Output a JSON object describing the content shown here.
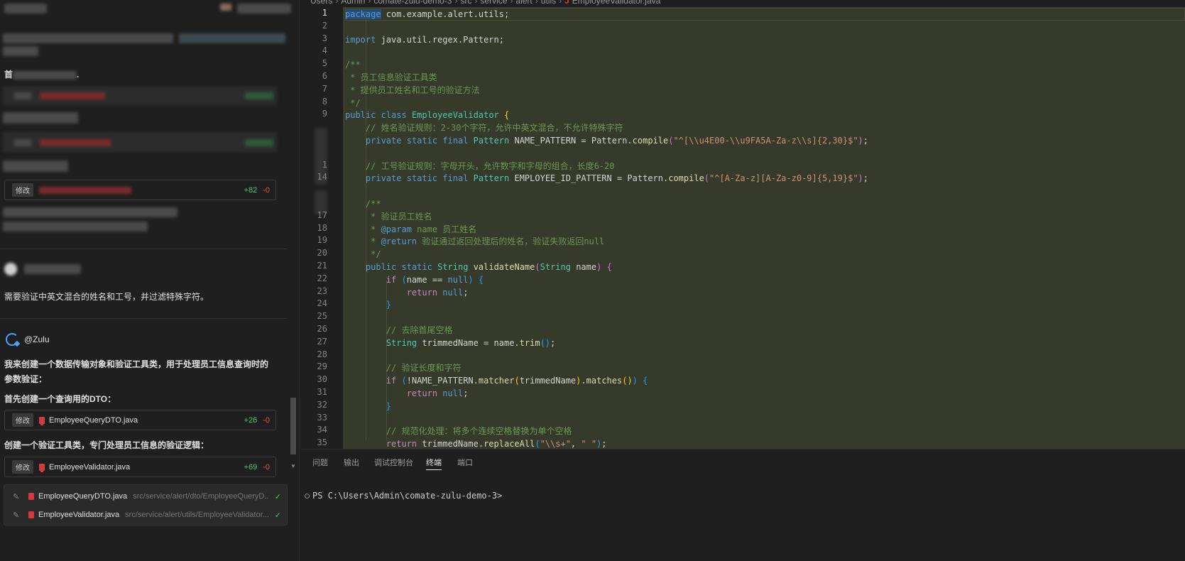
{
  "breadcrumb": [
    "Users",
    "Admin",
    "comate-zulu-demo-3",
    "src",
    "service",
    "alert",
    "utils"
  ],
  "breadcrumb_file": "EmployeeValidator.java",
  "breadcrumb_file_icon": "J",
  "chat": {
    "fragment_shou": "首",
    "fragment_dot": ".",
    "badge_partial": "修改",
    "add_partial": "+82",
    "del_partial": "-0",
    "user_message": "需要验证中英文混合的姓名和工号，并过滤特殊字符。",
    "agent_name": "@Zulu",
    "agent_intro_line1": "我来创建一个数据传输对象和验证工具类，用于处理员工信息查询时的",
    "agent_intro_line2": "参数验证：",
    "step1": "首先创建一个查询用的DTO：",
    "card1": {
      "badge": "修改",
      "name": "EmployeeQueryDTO.java",
      "add": "+26",
      "del": "-0"
    },
    "step2": "创建一个验证工具类，专门处理员工信息的验证逻辑：",
    "card2": {
      "badge": "修改",
      "name": "EmployeeValidator.java",
      "add": "+69",
      "del": "-0"
    },
    "changed_files": [
      {
        "name": "EmployeeQueryDTO.java",
        "path": "src/service/alert/dto/EmployeeQueryD..."
      },
      {
        "name": "EmployeeValidator.java",
        "path": "src/service/alert/utils/EmployeeValidator...."
      }
    ]
  },
  "editor": {
    "line_numbers": [
      "1",
      "2",
      "3",
      "4",
      "5",
      "6",
      "7",
      "8",
      "9",
      "",
      "",
      "",
      "1",
      "14",
      "",
      "",
      "17",
      "18",
      "19",
      "20",
      "21",
      "22",
      "23",
      "24",
      "25",
      "26",
      "27",
      "28",
      "29",
      "30",
      "31",
      "32",
      "33",
      "34",
      "35"
    ],
    "active_line": 1
  },
  "panel": {
    "tabs": [
      "问题",
      "输出",
      "调试控制台",
      "终端",
      "端口"
    ],
    "active_tab": 3,
    "terminal_prompt": "PS C:\\Users\\Admin\\comate-zulu-demo-3>"
  }
}
